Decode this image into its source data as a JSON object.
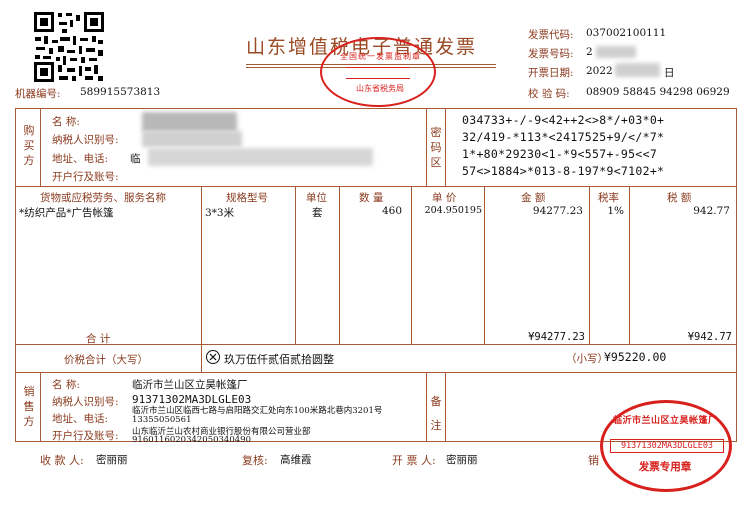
{
  "header": {
    "title": "山东增值税电子普通发票",
    "machine_label": "机器编号:",
    "machine_no": "589915573813",
    "invoice_code_label": "发票代码:",
    "invoice_code": "037002100111",
    "invoice_no_label": "发票号码:",
    "invoice_no": "2",
    "issue_date_label": "开票日期:",
    "issue_date": "2022",
    "issue_date_suffix": "日",
    "check_code_label": "校 验 码:",
    "check_code": "08909 58845 94298 06929",
    "seal_top_text": "全国统一发票监制章",
    "seal_bottom_text": "山东省税务局"
  },
  "buyer": {
    "section_label": "购买方",
    "name_label": "名      称:",
    "tax_id_label": "纳税人识别号:",
    "address_label": "地址、电话:",
    "address_partial": "临",
    "bank_label": "开户行及账号:"
  },
  "cipher": {
    "section_label": "密码区",
    "lines": [
      "034733+-/-9<42++2<>8*/+03*0+",
      "32/419-*113*<2417525+9/</*7*",
      "1*+80*29230<1-*9<557+-95<<7",
      "57<>1884>*013-8-197*9<7102+*"
    ]
  },
  "items": {
    "headers": {
      "name": "货物或应税劳务、服务名称",
      "spec": "规格型号",
      "unit": "单位",
      "qty": "数  量",
      "price": "单  价",
      "amount": "金  额",
      "rate": "税率",
      "tax": "税  额"
    },
    "rows": [
      {
        "name": "*纺织产品*广告帐篷",
        "spec": "3*3米",
        "unit": "套",
        "qty": "460",
        "price": "204.950195",
        "amount": "94277.23",
        "rate": "1%",
        "tax": "942.77"
      }
    ],
    "total_label": "合      计",
    "total_amount": "¥94277.23",
    "total_tax": "¥942.77"
  },
  "total": {
    "label": "价税合计（大写）",
    "words": "玖万伍仟贰佰贰拾圆整",
    "small_label": "（小写）",
    "small_value": "¥95220.00"
  },
  "seller": {
    "section_label": "销售方",
    "name_label": "名      称:",
    "name": "临沂市兰山区立昊帐篷厂",
    "tax_id_label": "纳税人识别号:",
    "tax_id": "91371302MA3DLGLE03",
    "address_label": "地址、电话:",
    "address": "临沂市兰山区临西七路与启阳路交汇处向东100米路北巷内3201号",
    "phone": "13355050561",
    "bank_label": "开户行及账号:",
    "bank": "山东临沂兰山农村商业银行股份有限公司营业部",
    "account": "9160116020342050340490"
  },
  "remarks": {
    "section_label": "备注"
  },
  "footer": {
    "payee_label": "收 款 人:",
    "payee": "密丽丽",
    "reviewer_label": "复核:",
    "reviewer": "高维霞",
    "drawer_label": "开 票 人:",
    "drawer": "密丽丽",
    "seller_label": "销"
  },
  "seller_seal": {
    "top_text": "临沂市兰山区立昊帐篷厂",
    "id_text": "91371302MA3DLGLE03",
    "bottom_text": "发票专用章"
  },
  "colors": {
    "frame": "#a85a34",
    "label_text": "#8a3a1e",
    "seal_red": "#d8201c"
  }
}
